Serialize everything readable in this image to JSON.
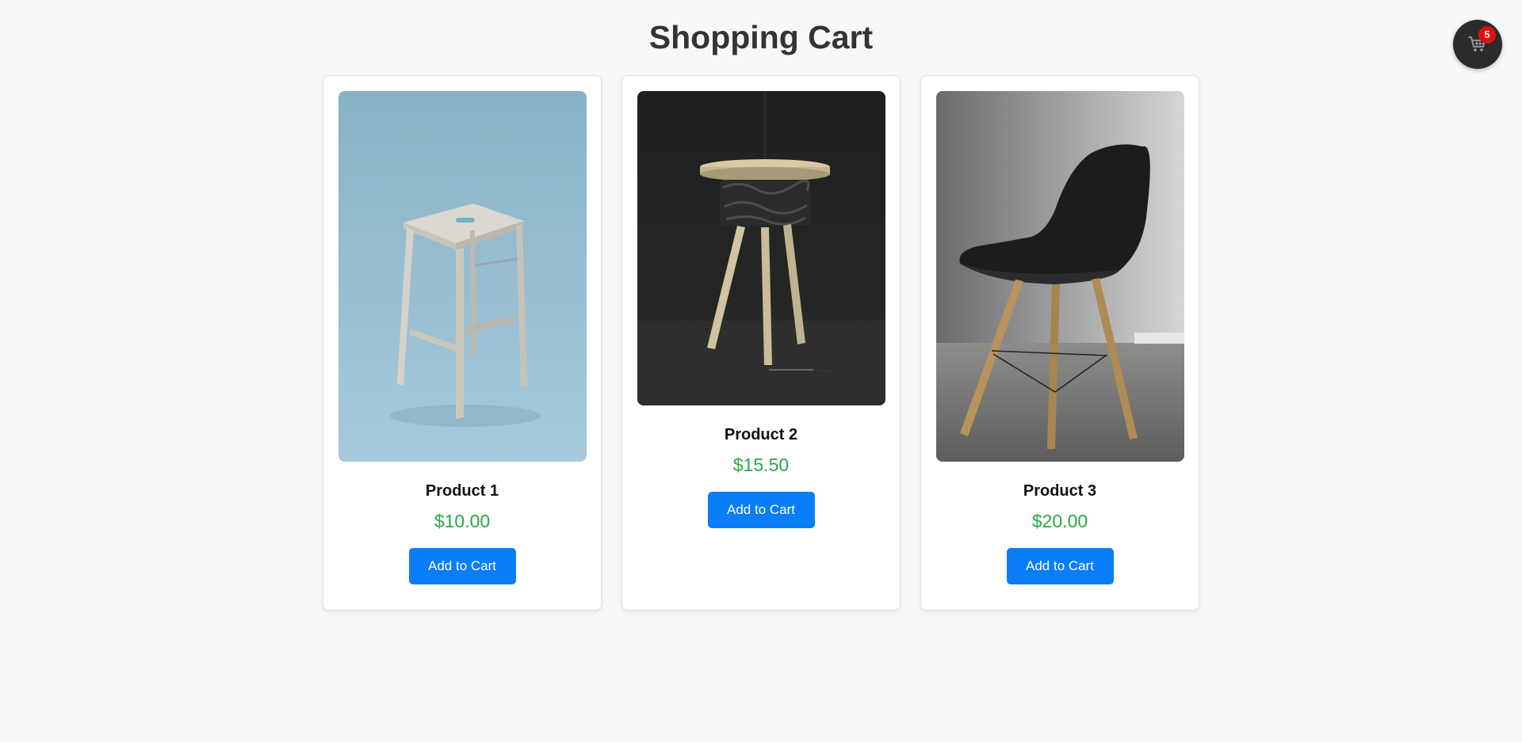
{
  "page": {
    "title": "Shopping Cart"
  },
  "cart": {
    "count": "5",
    "icon": "shopping-cart-icon"
  },
  "products": [
    {
      "name": "Product 1",
      "price": "$10.00",
      "button_label": "Add to Cart",
      "image_alt": "light wooden bar stool"
    },
    {
      "name": "Product 2",
      "price": "$15.50",
      "button_label": "Add to Cart",
      "image_alt": "round wooden stool"
    },
    {
      "name": "Product 3",
      "price": "$20.00",
      "button_label": "Add to Cart",
      "image_alt": "black chair with wooden legs"
    }
  ],
  "colors": {
    "background": "#f8f8f8",
    "price": "#28a745",
    "button": "#0a7ef8",
    "badge": "#e01010",
    "cart_button": "#2b2b2b"
  }
}
